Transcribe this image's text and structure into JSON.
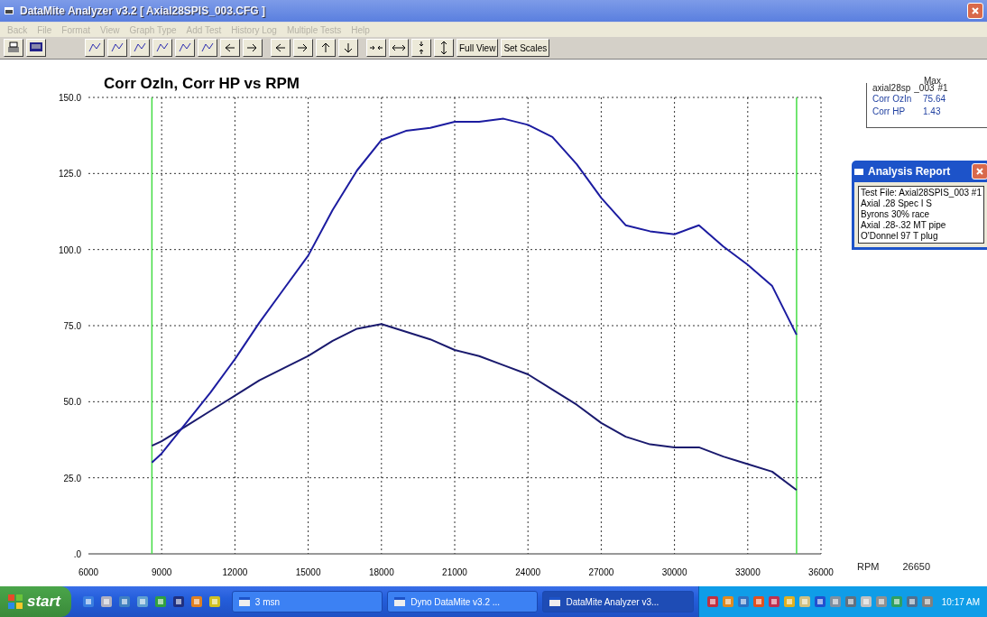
{
  "window": {
    "title": "DataMite Analyzer v3.2  [ Axial28SPIS_003.CFG ]"
  },
  "menu": [
    {
      "label": "Back",
      "disabled": true
    },
    {
      "label": "File",
      "disabled": true
    },
    {
      "label": "Format",
      "disabled": true
    },
    {
      "label": "View",
      "disabled": true
    },
    {
      "label": "Graph Type",
      "disabled": true
    },
    {
      "label": "Add Test",
      "disabled": true
    },
    {
      "label": "History Log",
      "disabled": true
    },
    {
      "label": "Multiple Tests",
      "disabled": true
    },
    {
      "label": "Help",
      "disabled": true
    }
  ],
  "toolbar": {
    "text_buttons": [
      "Full View",
      "Set Scales"
    ]
  },
  "chart": {
    "chart_data": {
      "type": "line",
      "title": "Corr OzIn, Corr HP vs RPM",
      "x": [
        8600,
        9000,
        10000,
        11000,
        12000,
        13000,
        14000,
        15000,
        16000,
        17000,
        18000,
        19000,
        20000,
        21000,
        22000,
        23000,
        24000,
        25000,
        26000,
        27000,
        28000,
        29000,
        30000,
        31000,
        32000,
        33000,
        34000,
        35000
      ],
      "series": [
        {
          "name": "Corr OzIn",
          "color": "#1a1a6e",
          "values": [
            35.5,
            37,
            42,
            47,
            52,
            57,
            61,
            65,
            70,
            74,
            75.5,
            73,
            70.5,
            67,
            65,
            62,
            59,
            54,
            49,
            43,
            38.5,
            36,
            35,
            35,
            32,
            29.5,
            27,
            21
          ]
        },
        {
          "name": "Corr HP",
          "color": "#1c1ca0",
          "values": [
            30,
            33,
            43,
            53,
            64,
            76,
            87,
            98,
            113,
            126,
            136,
            139,
            140,
            142,
            142,
            143,
            141,
            137,
            128,
            117,
            108,
            106,
            105,
            108,
            101,
            95,
            88,
            72
          ]
        }
      ],
      "xlim": [
        6000,
        36000
      ],
      "ylim": [
        0,
        150
      ],
      "grid": true,
      "ref_lines": [
        {
          "axis": "x",
          "value": 8600,
          "color": "#44dd44"
        },
        {
          "axis": "x",
          "value": 35000,
          "color": "#44dd44"
        }
      ],
      "xticks": [
        6000,
        9000,
        12000,
        15000,
        18000,
        21000,
        24000,
        27000,
        30000,
        33000,
        36000
      ],
      "yticks": [
        {
          "value": 0,
          "label": ".0"
        },
        {
          "value": 25,
          "label": "25.0"
        },
        {
          "value": 50,
          "label": "50.0"
        },
        {
          "value": 75,
          "label": "75.0"
        },
        {
          "value": 100,
          "label": "100.0"
        },
        {
          "value": 125,
          "label": "125.0"
        },
        {
          "value": 150,
          "label": "150.0"
        }
      ]
    },
    "rpm_label": "RPM",
    "rpm_value": "26650"
  },
  "legend": {
    "test": "axial28sp",
    "suffix": "_003",
    "header": "Max",
    "number": "#1",
    "rows": [
      {
        "value": "75.64"
      },
      {
        "value": "1.43"
      }
    ]
  },
  "analysis_report": {
    "title": "Analysis Report",
    "lines": [
      "Test File:  Axial28SPIS_003   #1",
      "Axial .28 Spec I S",
      "Byrons 30% race",
      "Axial .28-.32 MT pipe",
      "O'Donnel 97 T plug"
    ]
  },
  "taskbar": {
    "start": "start",
    "tasks": [
      {
        "label": "3 msn",
        "selected": false
      },
      {
        "label": "Dyno DataMite v3.2 ...",
        "selected": false
      },
      {
        "label": "DataMite Analyzer v3...",
        "selected": true
      }
    ],
    "clock": "10:17 AM"
  }
}
